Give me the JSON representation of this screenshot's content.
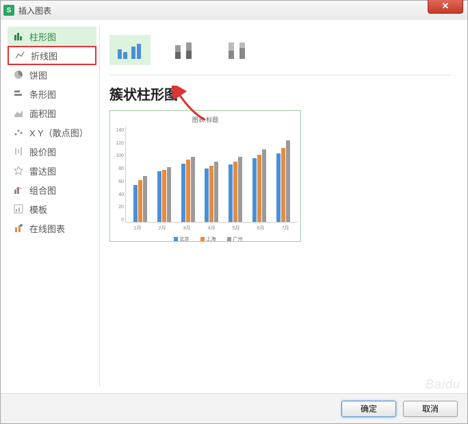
{
  "title": "插入图表",
  "close_glyph": "✕",
  "sidebar": {
    "items": [
      {
        "label": "柱形图",
        "active": true
      },
      {
        "label": "折线图",
        "highlight": true
      },
      {
        "label": "饼图"
      },
      {
        "label": "条形图"
      },
      {
        "label": "面积图"
      },
      {
        "label": "X Y（散点图）"
      },
      {
        "label": "股价图"
      },
      {
        "label": "雷达图"
      },
      {
        "label": "组合图"
      },
      {
        "label": "模板"
      },
      {
        "label": "在线图表"
      }
    ]
  },
  "subtitle": "簇状柱形图",
  "chart_data": {
    "type": "bar",
    "title": "图表 标题",
    "categories": [
      "1月",
      "2月",
      "3月",
      "4月",
      "5月",
      "6月"
    ],
    "series": [
      {
        "name": "北京",
        "color": "#4a90d9",
        "values": [
          58,
          80,
          92,
          84,
          90,
          100,
          108
        ]
      },
      {
        "name": "上海",
        "color": "#e88b3c",
        "values": [
          66,
          82,
          98,
          88,
          95,
          106,
          116
        ]
      },
      {
        "name": "广州",
        "color": "#9a9a9a",
        "values": [
          72,
          86,
          102,
          95,
          102,
          114,
          128
        ]
      }
    ],
    "categories_full": [
      "1月",
      "2月",
      "3月",
      "4月",
      "5月",
      "6月",
      "7月"
    ],
    "ylim": [
      0,
      140
    ],
    "yticks": [
      0,
      20,
      40,
      60,
      80,
      100,
      120,
      140
    ]
  },
  "buttons": {
    "ok": "确定",
    "cancel": "取消"
  }
}
